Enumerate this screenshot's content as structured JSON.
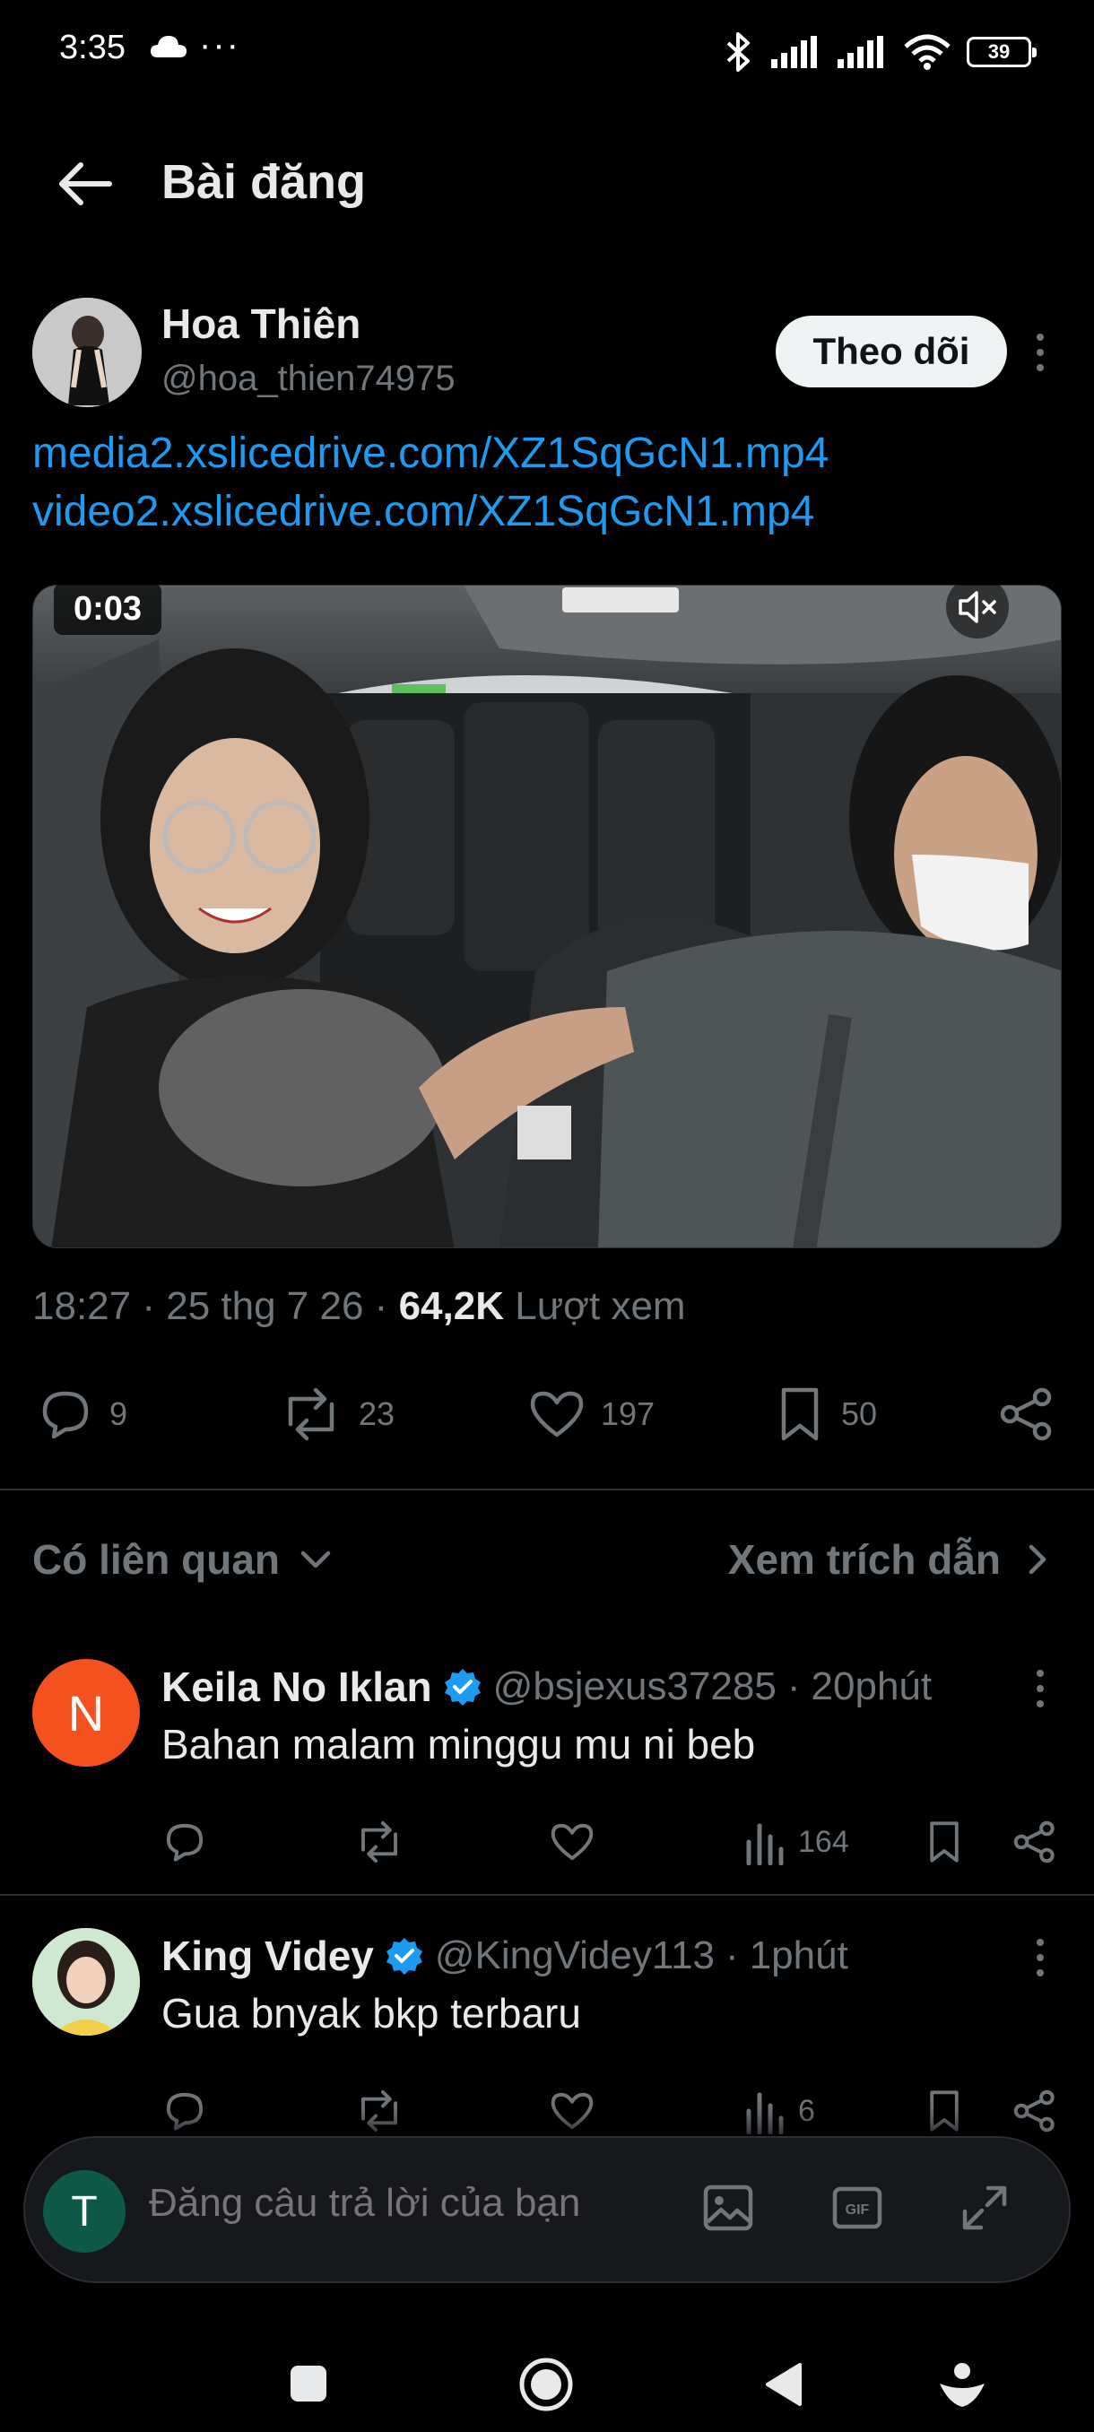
{
  "status_bar": {
    "time": "3:35",
    "battery": "39",
    "more": "···"
  },
  "header": {
    "title": "Bài đăng"
  },
  "post": {
    "author_name": "Hoa Thiên",
    "author_handle": "@hoa_thien74975",
    "follow_label": "Theo dõi",
    "link1": "media2.xslicedrive.com/XZ1SqGcN1.mp4",
    "link2": "video2.xslicedrive.com/XZ1SqGcN1.mp4",
    "video_duration": "0:03",
    "time": "18:27",
    "date": "25 thg 7 26",
    "views": "64,2K",
    "views_label": "Lượt xem",
    "replies": "9",
    "reposts": "23",
    "likes": "197",
    "bookmarks": "50"
  },
  "related": {
    "label": "Có liên quan",
    "quotes_label": "Xem trích dẫn"
  },
  "replies": [
    {
      "avatar_letter": "N",
      "avatar_color": "#f4511e",
      "name": "Keila No Iklan",
      "handle": "@bsjexus37285",
      "time": "20phút",
      "text": "Bahan malam minggu mu ni beb",
      "views": "164"
    },
    {
      "name": "King Videy",
      "handle": "@KingVidey113",
      "time": "1phút",
      "text": "Gua bnyak bkp terbaru",
      "views": "6"
    }
  ],
  "compose": {
    "avatar_letter": "T",
    "placeholder": "Đăng câu trả lời của bạn"
  },
  "colors": {
    "accent": "#1d9bf0",
    "background": "#000000",
    "muted": "#71767b"
  }
}
